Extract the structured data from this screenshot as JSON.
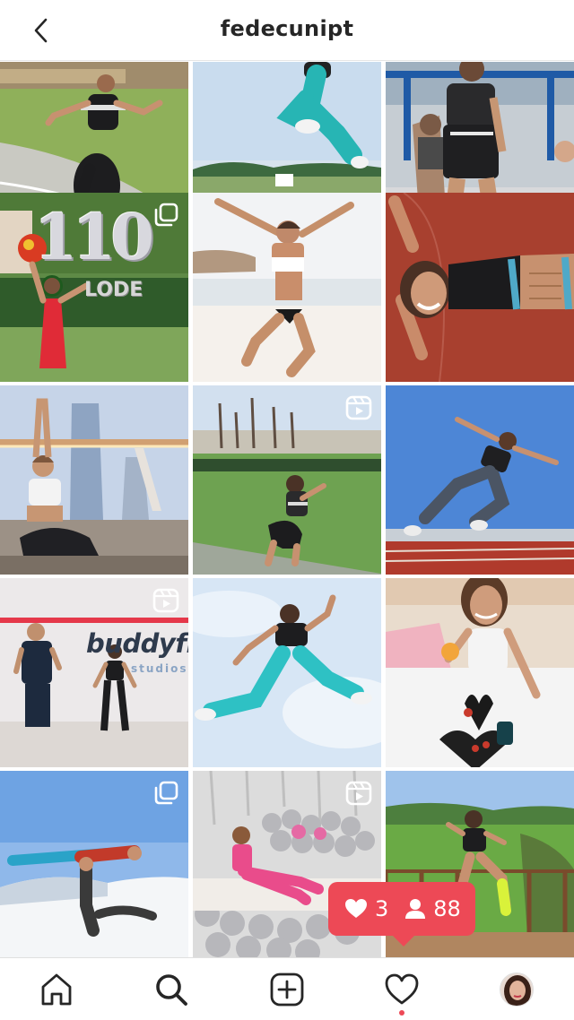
{
  "header": {
    "username": "fedecunipt"
  },
  "grid": {
    "posts": [
      {
        "type": "photo",
        "subject": "sprint-road"
      },
      {
        "type": "photo",
        "subject": "jump-stadium"
      },
      {
        "type": "photo",
        "subject": "track-run"
      },
      {
        "type": "carousel",
        "subject": "balloon-graduation",
        "balloon_text": "110",
        "sign_text": "LODE"
      },
      {
        "type": "photo",
        "subject": "beach-jump"
      },
      {
        "type": "photo",
        "subject": "lying-track"
      },
      {
        "type": "photo",
        "subject": "yoga-bridge"
      },
      {
        "type": "reel",
        "subject": "squat-field"
      },
      {
        "type": "photo",
        "subject": "sprint-track"
      },
      {
        "type": "reel",
        "subject": "studio-duo",
        "brand_text": "buddyfit",
        "brand_sub": "studios"
      },
      {
        "type": "photo",
        "subject": "sky-jump"
      },
      {
        "type": "photo",
        "subject": "snack-table"
      },
      {
        "type": "carousel",
        "subject": "snow-acro"
      },
      {
        "type": "reel",
        "subject": "balloons-sofa"
      },
      {
        "type": "photo",
        "subject": "hill-run"
      }
    ]
  },
  "activity": {
    "likes": "3",
    "followers": "88",
    "color": "#ed4956"
  },
  "tabbar": {
    "items": [
      "home-icon",
      "search-icon",
      "new-post-icon",
      "activity-heart-icon",
      "profile-avatar"
    ]
  }
}
